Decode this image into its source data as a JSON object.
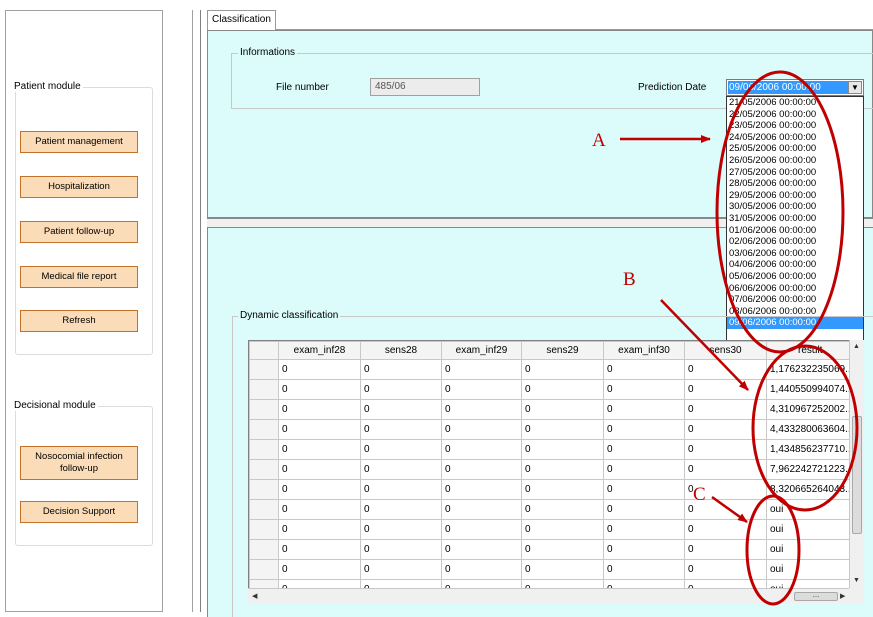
{
  "sidebar": {
    "patient_module": {
      "title": "Patient module",
      "buttons": [
        "Patient management",
        "Hospitalization",
        "Patient follow-up",
        "Medical file report",
        "Refresh"
      ]
    },
    "decisional_module": {
      "title": "Decisional module",
      "buttons": [
        "Nosocomial infection follow-up",
        "Decision Support"
      ]
    }
  },
  "tabs": [
    "Classification"
  ],
  "informations": {
    "title": "Informations",
    "file_number_label": "File number",
    "file_number_value": "485/06",
    "prediction_date_label": "Prediction Date",
    "prediction_date_value": "09/06/2006 00:00:00"
  },
  "date_options": [
    "21/05/2006 00:00:00",
    "22/05/2006 00:00:00",
    "23/05/2006 00:00:00",
    "24/05/2006 00:00:00",
    "25/05/2006 00:00:00",
    "26/05/2006 00:00:00",
    "27/05/2006 00:00:00",
    "28/05/2006 00:00:00",
    "29/05/2006 00:00:00",
    "30/05/2006 00:00:00",
    "31/05/2006 00:00:00",
    "01/06/2006 00:00:00",
    "02/06/2006 00:00:00",
    "03/06/2006 00:00:00",
    "04/06/2006 00:00:00",
    "05/06/2006 00:00:00",
    "06/06/2006 00:00:00",
    "07/06/2006 00:00:00",
    "08/06/2006 00:00:00",
    "09/06/2006 00:00:00"
  ],
  "selected_date_index": 19,
  "dynamic": {
    "title": "Dynamic classification",
    "columns": [
      "exam_inf28",
      "sens28",
      "exam_inf29",
      "sens29",
      "exam_inf30",
      "sens30",
      "result"
    ],
    "rows": [
      [
        "0",
        "0",
        "0",
        "0",
        "0",
        "0",
        "1,176232235069..."
      ],
      [
        "0",
        "0",
        "0",
        "0",
        "0",
        "0",
        "1,440550994074..."
      ],
      [
        "0",
        "0",
        "0",
        "0",
        "0",
        "0",
        "4,310967252002..."
      ],
      [
        "0",
        "0",
        "0",
        "0",
        "0",
        "0",
        "4,433280063604..."
      ],
      [
        "0",
        "0",
        "0",
        "0",
        "0",
        "0",
        "1,434856237710..."
      ],
      [
        "0",
        "0",
        "0",
        "0",
        "0",
        "0",
        "7,962242721223..."
      ],
      [
        "0",
        "0",
        "0",
        "0",
        "0",
        "0",
        "8,320665264043..."
      ],
      [
        "0",
        "0",
        "0",
        "0",
        "0",
        "0",
        "oui"
      ],
      [
        "0",
        "0",
        "0",
        "0",
        "0",
        "0",
        "oui"
      ],
      [
        "0",
        "0",
        "0",
        "0",
        "0",
        "0",
        "oui"
      ],
      [
        "0",
        "0",
        "0",
        "0",
        "0",
        "0",
        "oui"
      ],
      [
        "0",
        "0",
        "0",
        "0",
        "0",
        "0",
        "oui"
      ]
    ]
  },
  "annotations": [
    "A",
    "B",
    "C"
  ],
  "colors": {
    "pane_bg": "#dcfbfb",
    "button_bg": "#fbdcb8",
    "button_border": "#c4712a",
    "selection": "#3399ff",
    "annotation": "#c00000"
  }
}
